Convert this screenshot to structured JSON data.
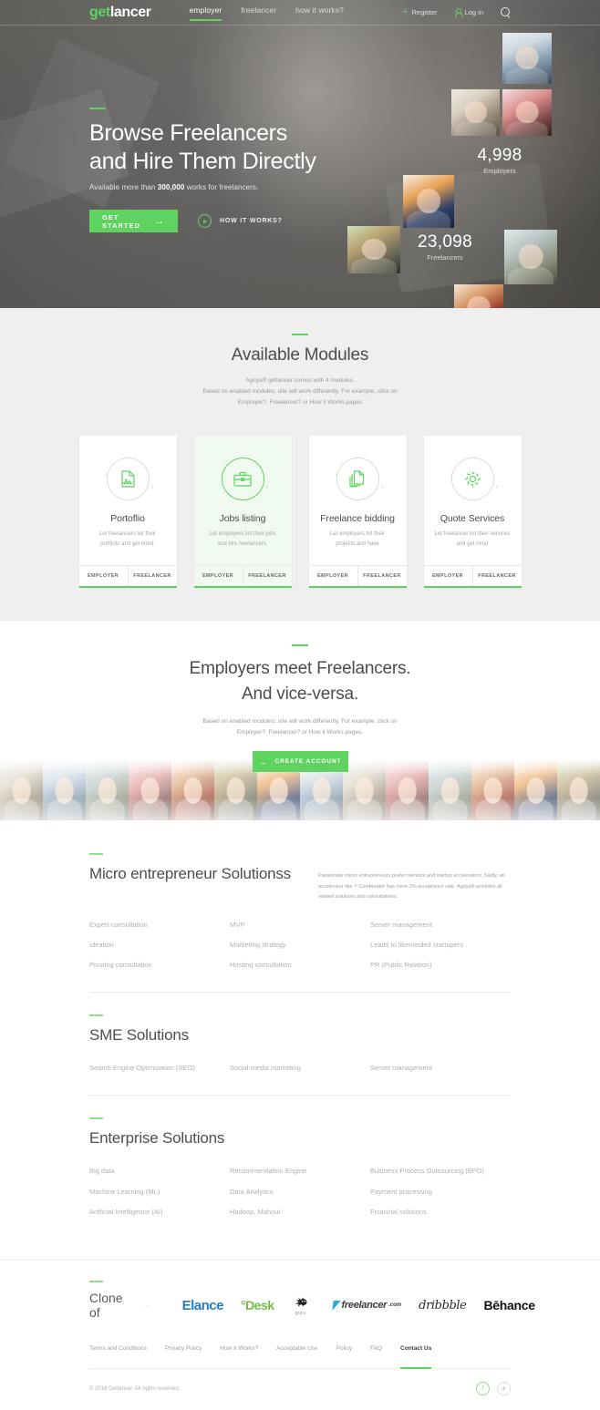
{
  "nav": {
    "logo_get": "get",
    "logo_lancer": "lancer",
    "links": [
      {
        "label": "employer",
        "active": true
      },
      {
        "label": "freelancer",
        "active": false
      },
      {
        "label": "how it works?",
        "active": false
      }
    ],
    "register": "Register",
    "login": "Log in",
    "search_icon": "search-icon"
  },
  "hero": {
    "title_line1": "Browse Freelancers",
    "title_line2": "and Hire Them Directly",
    "sub_before": "Available more than ",
    "sub_bold": "300,000",
    "sub_after": " works for freelancers.",
    "cta_primary": "GET STARTED",
    "cta_arrow": "→",
    "cta_secondary": "HOW IT WORKS?",
    "stats": [
      {
        "number": "4,998",
        "label": "Employers"
      },
      {
        "number": "23,098",
        "label": "Freelancers"
      }
    ]
  },
  "modules": {
    "title": "Available Modules",
    "desc_line1": "Agriya® getlancer comes with 4 modules.",
    "desc_line2": "Based on enabled modules, site will work differently. For example, click on",
    "desc_line3": "Employer?, Freelancer? or How it Works pages",
    "cards": [
      {
        "icon": "portfolio-image-icon",
        "title": "Portoflio",
        "desc_line1": "Let freelancers list their",
        "desc_line2": "portfolio and get hired.",
        "employer": "EMPLOYER",
        "freelancer": "FREELANCER",
        "active": false
      },
      {
        "icon": "briefcase-icon",
        "title": "Jobs listing",
        "desc_line1": "Let employers list their jobs",
        "desc_line2": "and hire freelancers.",
        "employer": "EMPLOYER",
        "freelancer": "FREELANCER",
        "active": true
      },
      {
        "icon": "documents-icon",
        "title": "Freelance bidding",
        "desc_line1": "Let employers list their",
        "desc_line2": "projects and have",
        "employer": "EMPLOYER",
        "freelancer": "FREELANCER",
        "active": false
      },
      {
        "icon": "gear-icon",
        "title": "Quote Services",
        "desc_line1": "Let freelancer list their services",
        "desc_line2": "and get hired",
        "employer": "EMPLOYER",
        "freelancer": "FREELANCER",
        "active": false
      }
    ]
  },
  "meet": {
    "title_line1": "Employers meet Freelancers.",
    "title_line2": "And vice-versa.",
    "desc_line1": "Based on enabled modules, site will work differently. For example, click on",
    "desc_line2": "Employer?, Freelancer? or How it Works pages.",
    "cta": "CREATE ACCOUNT",
    "cta_arrow": "→"
  },
  "solutions": [
    {
      "title": "Micro entrepreneur Solutionss",
      "paragraph": "Passionate micro entrepreneurs prefer mentors and startup accelerators. Sadly, an accelerator like Y Combinator has mere 3% acceptance rate. Agriya® provides all related solutions and consultations.",
      "columns": [
        [
          "Expert consultation",
          "Ideation",
          "Pivoting consultation"
        ],
        [
          "MVP",
          "Marketing strategy",
          "Hosting consultation"
        ],
        [
          "Server management",
          "Leads to likeminded startupers",
          "PR (Public Relation)"
        ]
      ]
    },
    {
      "title": "SME Solutions",
      "paragraph": "",
      "columns": [
        [
          "Search Engine Optimization (SEO)"
        ],
        [
          "Social media marketing"
        ],
        [
          "Server management"
        ]
      ]
    },
    {
      "title": "Enterprise Solutions",
      "paragraph": "",
      "columns": [
        [
          "Big data",
          "Machine Learning (ML)",
          "Artificial Intelligence (AI)"
        ],
        [
          "Recommendation Engine",
          "Data Analytics",
          "Hadoop, Mahout"
        ],
        [
          "Business Process Outsourcing (BPO)",
          "Payment processing",
          "Financial solutions"
        ]
      ]
    }
  ],
  "clone": {
    "title": "Clone of",
    "separator": "·",
    "logos": [
      {
        "name": "elance-logo",
        "text": "Elance"
      },
      {
        "name": "odesk-logo",
        "text": "°Desk"
      },
      {
        "name": "guru-logo",
        "text": "guru"
      },
      {
        "name": "freelancer-logo",
        "text": "freelancer",
        "suffix": ".com"
      },
      {
        "name": "dribbble-logo",
        "text": "dribbble"
      },
      {
        "name": "behance-logo",
        "text": "Bēhance"
      }
    ]
  },
  "footer": {
    "links": [
      {
        "label": "Terms and Conditions",
        "active": false
      },
      {
        "label": "Privacy Policy",
        "active": false
      },
      {
        "label": "How it Works?",
        "active": false
      },
      {
        "label": "Acceptable Use",
        "active": false
      },
      {
        "label": "Policy",
        "active": false
      },
      {
        "label": "FAQ",
        "active": false
      },
      {
        "label": "Contact Us",
        "active": true
      }
    ],
    "copyright": "© 2016 Getlancer. All rights reserved.",
    "socials": [
      {
        "name": "facebook-icon",
        "glyph": "f"
      },
      {
        "name": "twitter-icon",
        "glyph": "✈"
      }
    ]
  },
  "colors": {
    "accent": "#5fd35f",
    "dark_text": "#4a4a4a",
    "muted": "#a5a5a5"
  }
}
